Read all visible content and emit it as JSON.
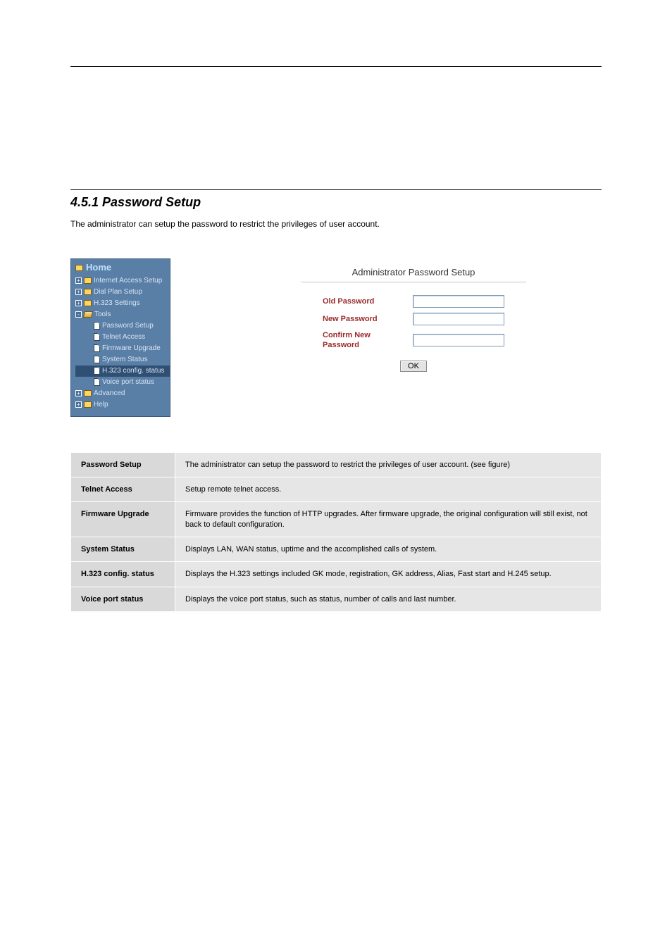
{
  "header": {
    "leftText": "",
    "rightText": ""
  },
  "section": {
    "title": "4.5.1 Password Setup",
    "intro": "The administrator can setup the password to restrict the privileges of user account."
  },
  "nav": {
    "home": "Home",
    "items": [
      {
        "label": "Internet Access Setup",
        "kind": "folder",
        "level": 1,
        "toggle": "+"
      },
      {
        "label": "Dial Plan Setup",
        "kind": "folder",
        "level": 1,
        "toggle": "+"
      },
      {
        "label": "H.323 Settings",
        "kind": "folder",
        "level": 1,
        "toggle": "+"
      },
      {
        "label": "Tools",
        "kind": "folder-open",
        "level": 1,
        "toggle": "-"
      },
      {
        "label": "Password Setup",
        "kind": "page",
        "level": 2
      },
      {
        "label": "Telnet Access",
        "kind": "page",
        "level": 2
      },
      {
        "label": "Firmware Upgrade",
        "kind": "page",
        "level": 2
      },
      {
        "label": "System Status",
        "kind": "page",
        "level": 2
      },
      {
        "label": "H.323 config. status",
        "kind": "page",
        "level": 2,
        "selected": true
      },
      {
        "label": "Voice port status",
        "kind": "page",
        "level": 2
      },
      {
        "label": "Advanced",
        "kind": "folder",
        "level": 1,
        "toggle": "+"
      },
      {
        "label": "Help",
        "kind": "folder",
        "level": 1,
        "toggle": "+"
      }
    ]
  },
  "panel": {
    "title": "Administrator Password Setup",
    "oldPwLabel": "Old Password",
    "newPwLabel": "New Password",
    "confirmLabel": "Confirm New Password",
    "okLabel": "OK"
  },
  "table": {
    "rows": [
      {
        "left": "Password Setup",
        "right": "The administrator can setup the password to restrict the privileges of user account. (see figure)"
      },
      {
        "left": "Telnet Access",
        "right": "Setup remote telnet access."
      },
      {
        "left": "Firmware Upgrade",
        "right": "Firmware provides the function of HTTP upgrades. After firmware upgrade, the original configuration will still exist, not back to default configuration."
      },
      {
        "left": "System Status",
        "right": "Displays LAN, WAN status, uptime and the accomplished calls of system."
      },
      {
        "left": "H.323 config. status",
        "right": "Displays the H.323 settings included GK mode, registration, GK address, Alias, Fast start and H.245 setup."
      },
      {
        "left": "Voice port status",
        "right": "Displays the voice port status, such as status, number of calls and last number."
      }
    ]
  }
}
